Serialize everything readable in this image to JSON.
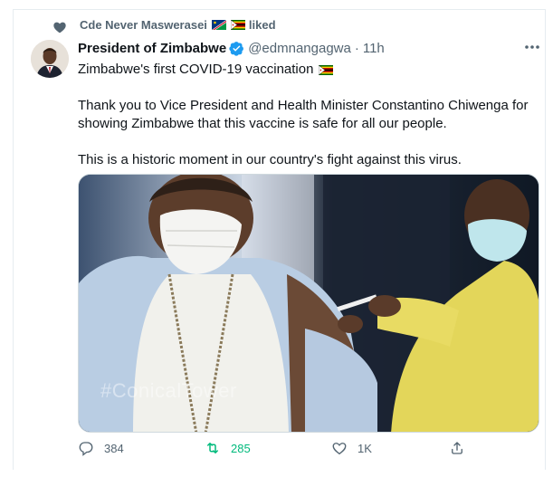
{
  "social_context": {
    "name": "Cde Never Maswerasei",
    "action": "liked"
  },
  "tweet": {
    "author_name": "President of Zimbabwe",
    "handle": "@edmnangagwa",
    "separator": "·",
    "time": "11h",
    "text_line1": "Zimbabwe's first COVID-19 vaccination",
    "text_para2": "Thank you to Vice President and Health Minister Constantino Chiwenga for showing Zimbabwe that this vaccine is safe for all our people.",
    "text_para3": "This is a historic moment in our country's fight against this virus.",
    "media_watermark": "#ConicalTower"
  },
  "actions": {
    "reply_count": "384",
    "retweet_count": "285",
    "like_count": "1K"
  },
  "colors": {
    "verified": "#1d9bf0",
    "retweeted": "#00ba7c",
    "muted": "#536471"
  },
  "icons": {
    "social": "heart-icon",
    "verified": "verified-badge-icon",
    "more": "more-options-icon",
    "reply": "reply-icon",
    "retweet": "retweet-icon",
    "like": "heart-icon",
    "share": "share-icon"
  }
}
